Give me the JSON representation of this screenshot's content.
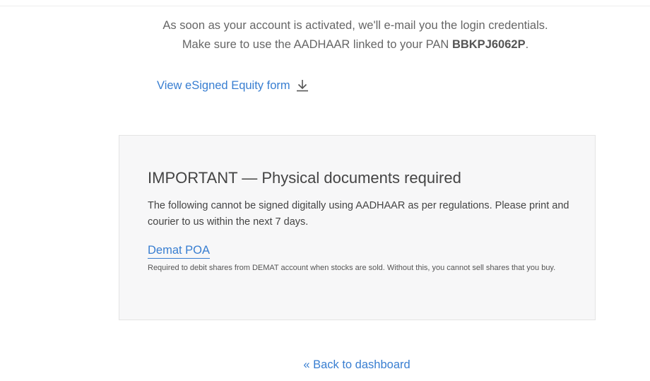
{
  "activation": {
    "line1": "As soon as your account is activated, we'll e-mail you the login credentials.",
    "line2_prefix": "Make sure to use the AADHAAR linked to your PAN ",
    "pan": "BBKPJ6062P",
    "line2_suffix": "."
  },
  "esign": {
    "link_label": "View eSigned Equity form",
    "icon": "download-icon"
  },
  "important": {
    "title": "IMPORTANT — Physical documents required",
    "description": "The following cannot be signed digitally using AADHAAR as per regulations. Please print and courier to us within the next 7 days.",
    "document": {
      "label": "Demat POA",
      "note": "Required to debit shares from DEMAT account when stocks are sold. Without this, you cannot sell shares that you buy."
    }
  },
  "footer": {
    "back_label": "« Back to dashboard"
  },
  "colors": {
    "link": "#387ed1",
    "box_background": "#f7f7f8",
    "text": "#444444"
  }
}
